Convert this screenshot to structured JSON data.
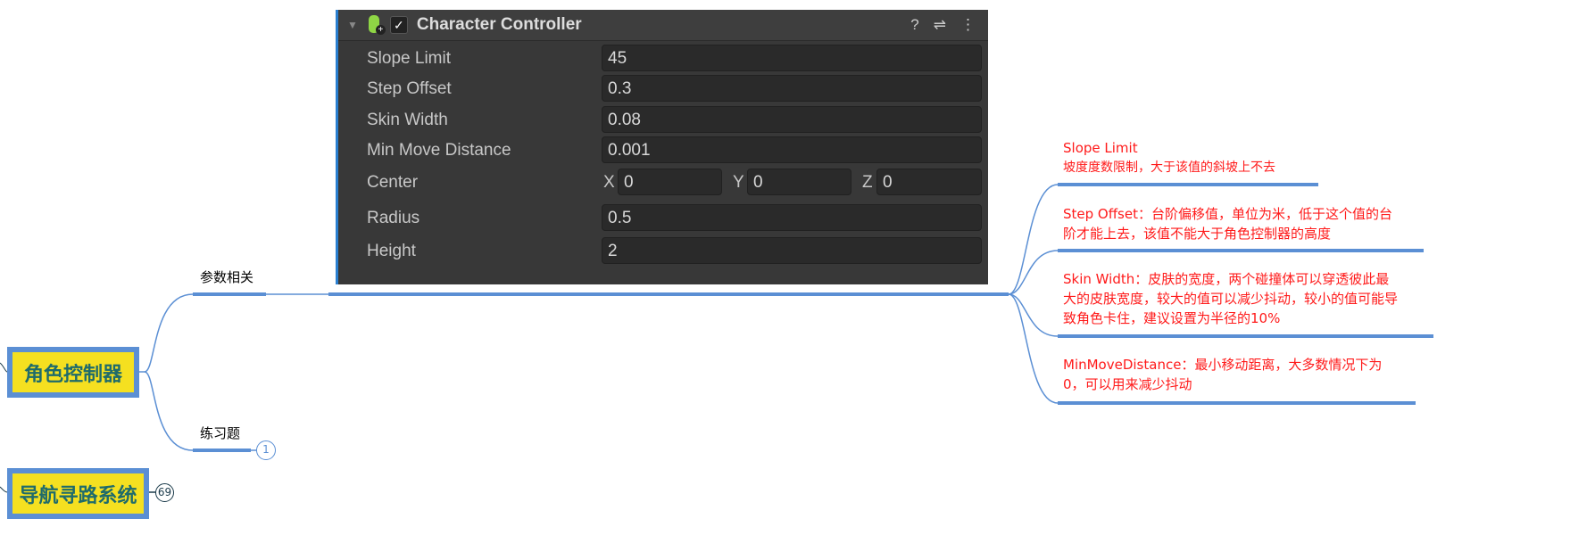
{
  "inspector": {
    "title": "Character Controller",
    "enabled": true,
    "fields": [
      {
        "label": "Slope Limit",
        "value": "45"
      },
      {
        "label": "Step Offset",
        "value": "0.3"
      },
      {
        "label": "Skin Width",
        "value": "0.08"
      },
      {
        "label": "Min Move Distance",
        "value": "0.001"
      }
    ],
    "center": {
      "label": "Center",
      "x_label": "X",
      "x": "0",
      "y_label": "Y",
      "y": "0",
      "z_label": "Z",
      "z": "0"
    },
    "radius": {
      "label": "Radius",
      "value": "0.5"
    },
    "height": {
      "label": "Height",
      "value": "2"
    },
    "icons": {
      "help": "?",
      "preset": "⇌",
      "menu": "⋮"
    }
  },
  "mindmap": {
    "node_main": "角色控制器",
    "node_nav": "导航寻路系统",
    "nav_count": "69",
    "branch_params": "参数相关",
    "branch_exercise": "练习题",
    "exercise_count": "1",
    "notes": [
      {
        "line1": "Slope Limit",
        "line2": "坡度度数限制，大于该值的斜坡上不去"
      },
      {
        "line1": "Step Offset：台阶偏移值，单位为米，低于这个值的台",
        "line2": "阶才能上去，该值不能大于角色控制器的高度"
      },
      {
        "line1": "Skin Width：皮肤的宽度，两个碰撞体可以穿透彼此最",
        "line2": "大的皮肤宽度，较大的值可以减少抖动，较小的值可能导",
        "line3": "致角色卡住，建议设置为半径的10%"
      },
      {
        "line1": "MinMoveDistance：最小移动距离，大多数情况下为",
        "line2": "0，可以用来减少抖动"
      }
    ]
  }
}
